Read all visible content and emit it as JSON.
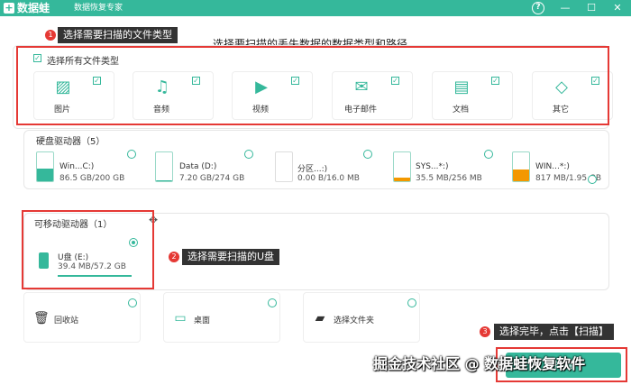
{
  "app": {
    "logo_glyph": "+",
    "name": "数据蛙",
    "subtitle": "数据恢复专家",
    "help_glyph": "?",
    "minimize_glyph": "—",
    "maximize_glyph": "☐",
    "close_glyph": "✕",
    "accent_color": "#35b89b"
  },
  "instruction": "选择要扫描的丢失数据的数据类型和路径。",
  "callouts": [
    {
      "badge": "1",
      "text": "选择需要扫描的文件类型"
    },
    {
      "badge": "2",
      "text": "选择需要扫描的U盘"
    },
    {
      "badge": "3",
      "text": "选择完毕，点击【扫描】"
    }
  ],
  "file_types": {
    "check_all_label": "选择所有文件类型",
    "items": [
      {
        "label": "图片",
        "icon": "image-icon",
        "checked": true
      },
      {
        "label": "音频",
        "icon": "music-icon",
        "checked": true
      },
      {
        "label": "视频",
        "icon": "video-icon",
        "checked": true
      },
      {
        "label": "电子邮件",
        "icon": "email-icon",
        "checked": true
      },
      {
        "label": "文档",
        "icon": "document-icon",
        "checked": true
      },
      {
        "label": "其它",
        "icon": "other-icon",
        "checked": true
      }
    ]
  },
  "hard_drives": {
    "title": "硬盘驱动器（5）",
    "items": [
      {
        "name": "Win...C:)",
        "size": "86.5 GB/200 GB",
        "used_fraction": 0.43
      },
      {
        "name": "Data (D:)",
        "size": "7.20 GB/274 GB",
        "used_fraction": 0.03
      },
      {
        "name": "分区...:)",
        "size": "0.00  B/16.0 MB",
        "used_fraction": 0.0
      },
      {
        "name": "SYS...*:)",
        "size": "35.5 MB/256 MB",
        "used_fraction": 0.14
      },
      {
        "name": "WIN...*:)",
        "size": "817 MB/1.95 GB",
        "used_fraction": 0.42
      }
    ]
  },
  "removable_drives": {
    "title": "可移动驱动器（1）",
    "items": [
      {
        "name": "U盘 (E:)",
        "size": "39.4 MB/57.2 GB",
        "selected": true
      }
    ]
  },
  "locations": [
    {
      "label": "回收站",
      "icon": "trash-icon"
    },
    {
      "label": "桌面",
      "icon": "desktop-icon"
    },
    {
      "label": "选择文件夹",
      "icon": "folder-icon"
    }
  ],
  "scan_button": "扫描",
  "watermark": "掘金技术社区 @ 数据蛙恢复软件"
}
